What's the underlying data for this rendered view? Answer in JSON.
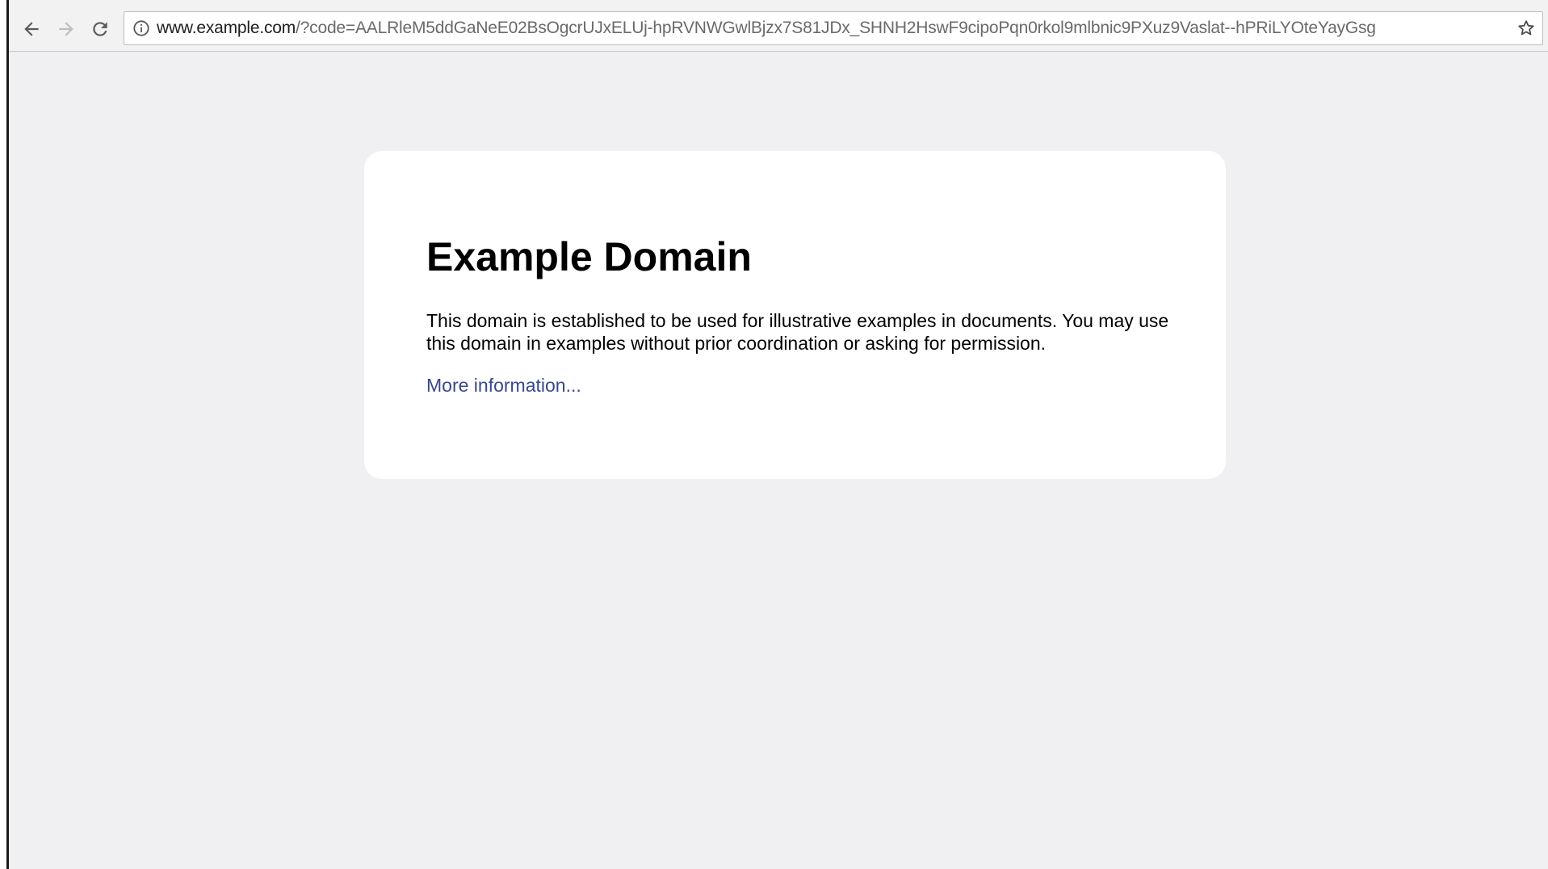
{
  "browser": {
    "back_icon": "arrow-left-icon",
    "forward_icon": "arrow-right-icon",
    "reload_icon": "reload-icon",
    "info_icon": "info-circle-icon",
    "bookmark_icon": "star-outline-icon",
    "url_host": "www.example.com",
    "url_rest": "/?code=AALRleM5ddGaNeE02BsOgcrUJxELUj-hpRVNWGwlBjzx7S81JDx_SHNH2HswF9cipoPqn0rkol9mlbnic9PXuz9Vaslat--hPRiLYOteYayGsg"
  },
  "page": {
    "title": "Example Domain",
    "description": "This domain is established to be used for illustrative examples in documents. You may use this domain in examples without prior coordination or asking for permission.",
    "more_link": "More information..."
  },
  "colors": {
    "page_background": "#f0f0f2",
    "card_background": "#ffffff",
    "link": "#38488f",
    "disabled_icon": "#bdbdbd"
  }
}
